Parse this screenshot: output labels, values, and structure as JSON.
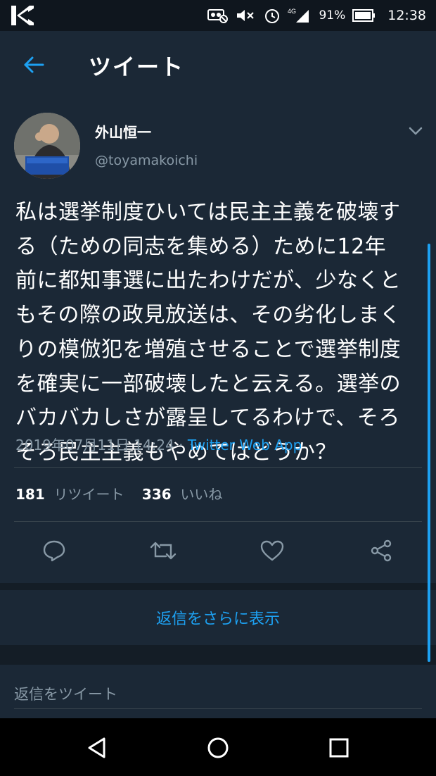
{
  "status_bar": {
    "battery": "91%",
    "time": "12:38",
    "network": "4G",
    "icons": [
      "app-logo-icon",
      "vr-icon",
      "mute-icon",
      "alarm-icon",
      "signal-icon",
      "battery-icon"
    ]
  },
  "header": {
    "title": "ツイート",
    "back_icon": "back-arrow-icon"
  },
  "tweet": {
    "author_name": "外山恒一",
    "author_handle": "@toyamakoichi",
    "text": "私は選挙制度ひいては民主主義を破壊す\nる（ための同志を集める）ために12年\n前に都知事選に出たわけだが、少なくと\nもその際の政見放送は、その劣化しまく\nりの模倣犯を増殖させることで選挙制度\nを確実に一部破壊したと云える。選挙の\nバカバカしさが露呈してるわけで、そろ\nそろ民主主義もやめてはどうか？",
    "timestamp": "2019年07月11日 14:24",
    "separator": " · ",
    "source": "Twitter Web App",
    "retweets_count": "181",
    "retweets_label": "リツイート",
    "likes_count": "336",
    "likes_label": "いいね",
    "action_icons": [
      "reply-icon",
      "retweet-icon",
      "like-icon",
      "share-icon"
    ]
  },
  "more_replies": {
    "label": "返信をさらに表示"
  },
  "reply": {
    "placeholder": "返信をツイート"
  },
  "colors": {
    "accent": "#1da1f2",
    "background": "#141d26",
    "card": "#1b2836",
    "secondary_text": "#8899a6"
  },
  "nav_bar": {
    "icons": [
      "nav-back-icon",
      "nav-home-icon",
      "nav-recents-icon"
    ]
  }
}
